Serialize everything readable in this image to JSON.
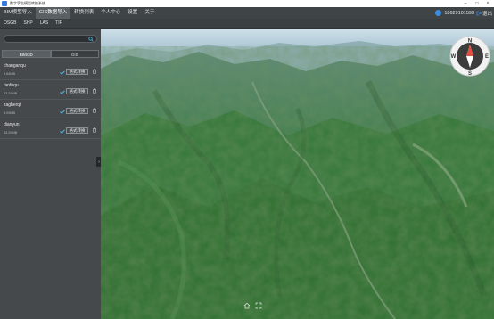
{
  "window": {
    "title": "数字孪生模型转换系统"
  },
  "menu": {
    "items": [
      {
        "label": "BIM模型导入",
        "active": false
      },
      {
        "label": "GIS数据导入",
        "active": true
      },
      {
        "label": "转换列表",
        "active": false
      },
      {
        "label": "个人中心",
        "active": false
      },
      {
        "label": "设置",
        "active": false
      },
      {
        "label": "关于",
        "active": false
      }
    ]
  },
  "user": {
    "phone": "18629101593",
    "logout_label": "退出"
  },
  "toolbar": {
    "items": [
      "OSGB",
      "SHP",
      "LAS",
      "TIF"
    ]
  },
  "sidebar": {
    "search_placeholder": "",
    "tabs": [
      {
        "label": "BIM/3D",
        "active": true
      },
      {
        "label": "GIS",
        "active": false
      }
    ],
    "convert_label": "格式转换",
    "files": [
      {
        "name": "changanqu",
        "size": "9.64MB"
      },
      {
        "name": "fanfuqu",
        "size": "33.29MB"
      },
      {
        "name": "zagherqi",
        "size": "8.09MB"
      },
      {
        "name": "dianyun",
        "size": "33.29MB"
      }
    ]
  },
  "compass": {
    "n": "N",
    "e": "E",
    "s": "S",
    "w": "W"
  },
  "colors": {
    "menu_bg": "#3f4447",
    "sidebar_bg": "#45494c",
    "accent": "#3d8be0",
    "check": "#4fc3f7"
  },
  "icons": [
    "app-icon",
    "minimize-icon",
    "maximize-icon",
    "close-icon",
    "user-icon",
    "logout-icon",
    "search-icon",
    "check-icon",
    "delete-icon",
    "collapse-arrow-icon",
    "compass-icon",
    "home-icon",
    "fullscreen-icon"
  ]
}
